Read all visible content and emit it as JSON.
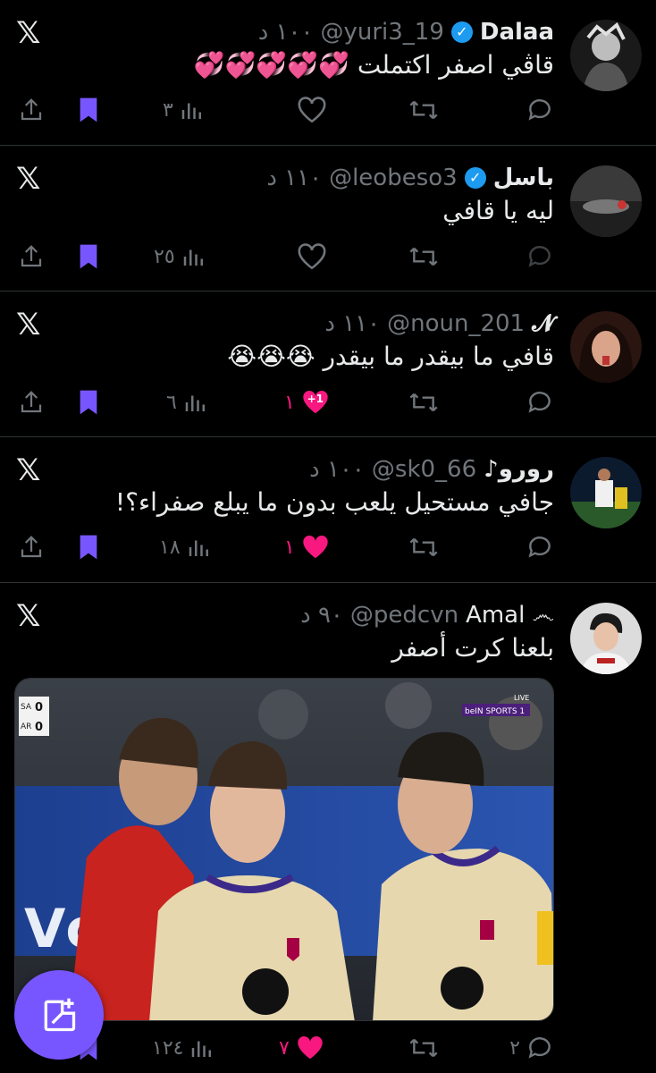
{
  "colors": {
    "background": "#000000",
    "text": "#e7e9ea",
    "muted": "#71767b",
    "verified": "#1d9bf0",
    "bookmark": "#7856ff",
    "like": "#f91880",
    "fab": "#7856ff"
  },
  "tweets": [
    {
      "name": "Dalaa",
      "verified": true,
      "handle": "@yuri3_19",
      "time": "١٠٠ د",
      "text": "قاڤي اصفر اكتملت 💞💞💞💞💞",
      "reply_count": "",
      "like_count": "",
      "like_badge": "",
      "views": "٣",
      "bookmarked": true
    },
    {
      "name": "باسل",
      "verified": true,
      "handle": "@leobeso3",
      "time": "١١٠ د",
      "text": "ليه يا قافي",
      "reply_count": "",
      "like_count": "",
      "like_badge": "",
      "views": "٢٥",
      "bookmarked": true
    },
    {
      "name": "𝓝",
      "verified": false,
      "handle": "@noun_201",
      "time": "١١٠ د",
      "text": "قافي ما بيقدر ما بيقدر 😭😭😭",
      "reply_count": "",
      "like_count": "١",
      "like_badge": "+1",
      "views": "٦",
      "bookmarked": true
    },
    {
      "name": "رورو♪",
      "verified": false,
      "handle": "@sk0_66",
      "time": "١٠٠ د",
      "text": "جافي مستحيل يلعب بدون ما يبلع صفراء؟!",
      "reply_count": "",
      "like_count": "١",
      "like_badge": "",
      "views": "١٨",
      "bookmarked": true
    },
    {
      "name": "Amal",
      "name_symbol": "෴",
      "verified": false,
      "handle": "@pedcvn",
      "time": "٩٠ د",
      "text": "بلعنا كرت أصفر",
      "reply_count": "٢",
      "like_count": "٧",
      "like_badge": "",
      "views": "١٢٤",
      "bookmarked": true,
      "media": {
        "scoreboard": [
          "SA",
          "0",
          "AR",
          "0"
        ],
        "broadcaster": "beIN SPORTS 1",
        "live": "LIVE"
      }
    }
  ],
  "icons": {
    "x_logo": "x-logo-icon",
    "reply": "reply-icon",
    "retweet": "retweet-icon",
    "like": "heart-icon",
    "views": "views-icon",
    "bookmark": "bookmark-icon",
    "share": "share-icon",
    "compose": "compose-icon"
  }
}
